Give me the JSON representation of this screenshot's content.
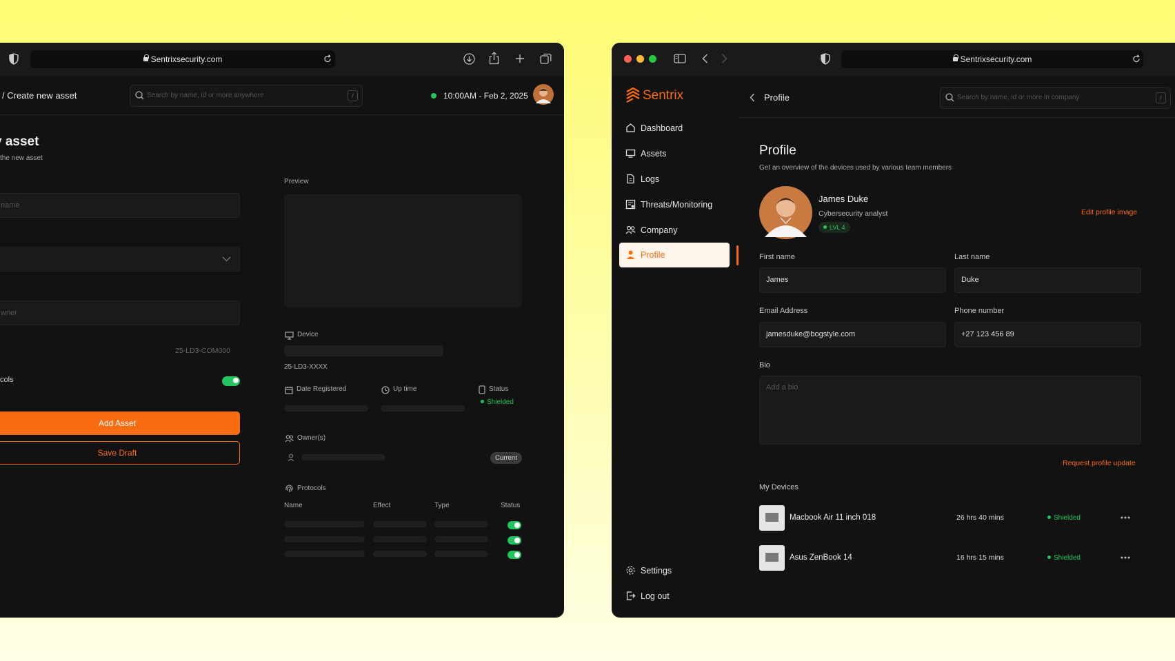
{
  "left_window": {
    "url": "Sentrixsecurity.com",
    "breadcrumb": "/ Create new asset",
    "search_placeholder": "Search by name, id or more  anywhere",
    "search_shortcut": "/",
    "datetime": "10:00AM - Feb 2, 2025",
    "form": {
      "title": "v asset",
      "subtitle": "the new asset",
      "name_placeholder": "name",
      "owner_placeholder": "wner",
      "asset_code": "25-LD3-COM000",
      "protocols_label": "cols",
      "protocols_toggle": true,
      "add_button": "Add Asset",
      "draft_button": "Save Draft"
    },
    "preview": {
      "label": "Preview",
      "device_label": "Device",
      "device_id": "25-LD3-XXXX",
      "date_registered_label": "Date Registered",
      "uptime_label": "Up time",
      "status_label": "Status",
      "status_value": "Shielded",
      "owners_label": "Owner(s)",
      "current_badge": "Current",
      "protocols_label": "Protocols",
      "columns": [
        "Name",
        "Effect",
        "Type",
        "Status"
      ]
    }
  },
  "right_window": {
    "url": "Sentrixsecurity.com",
    "brand": "Sentrix",
    "header_title": "Profile",
    "search_placeholder": "Search by name, id or more in company",
    "search_shortcut": "/",
    "nav": [
      {
        "label": "Dashboard",
        "icon": "home-icon"
      },
      {
        "label": "Assets",
        "icon": "assets-icon"
      },
      {
        "label": "Logs",
        "icon": "file-icon"
      },
      {
        "label": "Threats/Monitoring",
        "icon": "monitor-icon"
      },
      {
        "label": "Company",
        "icon": "people-icon"
      },
      {
        "label": "Profile",
        "icon": "user-icon",
        "active": true
      }
    ],
    "settings_label": "Settings",
    "logout_label": "Log out",
    "profile": {
      "title": "Profile",
      "subtitle": "Get an overview of the devices used by various team members",
      "name": "James Duke",
      "role": "Cybersecurity analyst",
      "level": "LVL 4",
      "edit_image": "Edit profile image",
      "first_name_label": "First name",
      "first_name": "James",
      "last_name_label": "Last name",
      "last_name": "Duke",
      "email_label": "Email Address",
      "email": "jamesduke@bogstyle.com",
      "phone_label": "Phone number",
      "phone": "+27 123 456 89",
      "bio_label": "Bio",
      "bio_placeholder": "Add a bio",
      "request_update": "Request profile update",
      "devices_label": "My Devices",
      "devices": [
        {
          "name": "Macbook Air 11 inch 018",
          "uptime": "26 hrs 40 mins",
          "status": "Shielded"
        },
        {
          "name": "Asus ZenBook 14",
          "uptime": "16 hrs 15 mins",
          "status": "Shielded"
        }
      ]
    }
  },
  "colors": {
    "accent": "#f96c11",
    "success": "#22c55e",
    "panel": "#121212"
  }
}
